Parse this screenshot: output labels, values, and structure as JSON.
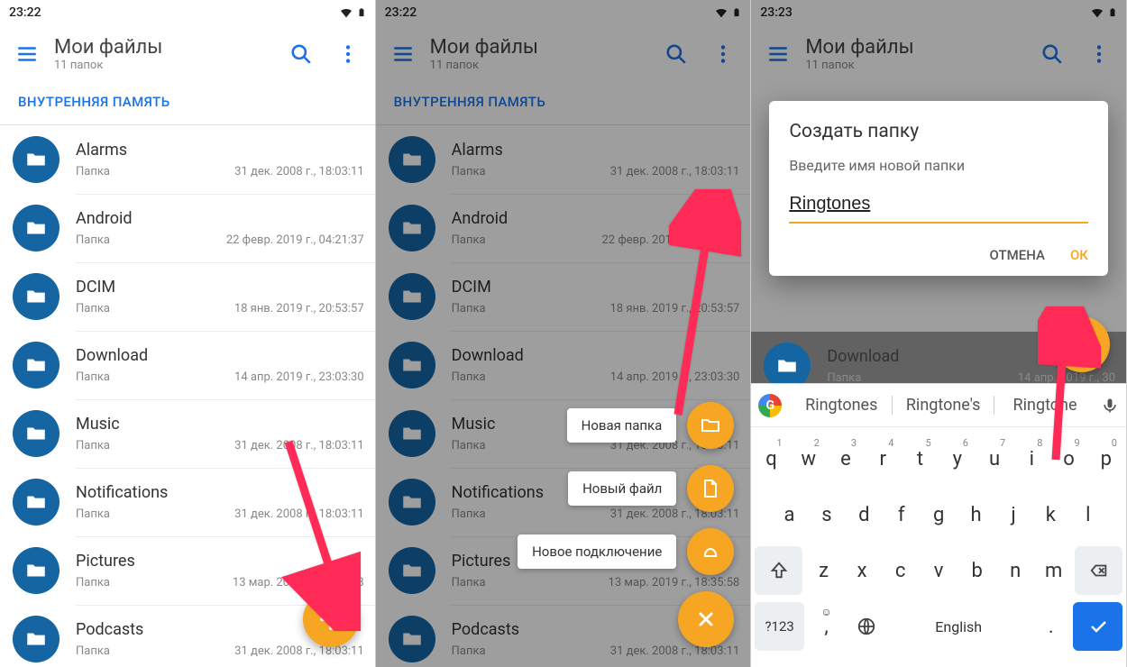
{
  "status": {
    "time_a": "23:22",
    "time_b": "23:22",
    "time_c": "23:23"
  },
  "appbar": {
    "title": "Мои файлы",
    "subtitle": "11 папок"
  },
  "breadcrumb": "ВНУТРЕННЯЯ ПАМЯТЬ",
  "item_type": "Папка",
  "files": [
    {
      "name": "Alarms",
      "date": "31 дек. 2008 г., 18:03:11"
    },
    {
      "name": "Android",
      "date": "22 февр. 2019 г., 04:21:37"
    },
    {
      "name": "DCIM",
      "date": "18 янв. 2019 г., 20:53:57"
    },
    {
      "name": "Download",
      "date": "14 апр. 2019 г., 23:03:30"
    },
    {
      "name": "Music",
      "date": "31 дек. 2008 г., 18:03:11"
    },
    {
      "name": "Notifications",
      "date": "31 дек. 2008 г., 18:03:11"
    },
    {
      "name": "Pictures",
      "date": "13 мар. 2019 г., 18:35:58"
    },
    {
      "name": "Podcasts",
      "date": "31 дек. 2008 г., 18:03:11"
    }
  ],
  "speed_dial": {
    "new_folder": "Новая папка",
    "new_file": "Новый файл",
    "new_connection": "Новое подключение"
  },
  "dialog": {
    "title": "Создать папку",
    "hint": "Введите имя новой папки",
    "value": "Ringtones",
    "cancel": "ОТМЕНА",
    "ok": "ОК"
  },
  "screen3": {
    "download_name": "Download",
    "download_date_short": "14 апр. 2019 г.,        30"
  },
  "suggestions": [
    "Ringtones",
    "Ringtone's",
    "Ringtone"
  ],
  "keyboard": {
    "row1": [
      "q",
      "w",
      "e",
      "r",
      "t",
      "y",
      "u",
      "i",
      "o",
      "p"
    ],
    "nums": [
      "1",
      "2",
      "3",
      "4",
      "5",
      "6",
      "7",
      "8",
      "9",
      "0"
    ],
    "row2": [
      "a",
      "s",
      "d",
      "f",
      "g",
      "h",
      "j",
      "k",
      "l"
    ],
    "row3": [
      "z",
      "x",
      "c",
      "v",
      "b",
      "n",
      "m"
    ],
    "symkey": "?123",
    "space": "English"
  }
}
